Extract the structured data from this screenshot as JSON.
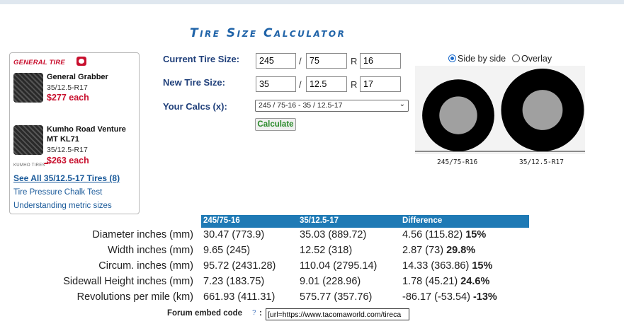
{
  "title": "Tire Size Calculator",
  "ad": {
    "brand1": "GENERAL TIRE",
    "product1": {
      "name": "General Grabber",
      "size": "35/12.5-R17",
      "price": "$277 each"
    },
    "brand2": "KUMHO TIRES",
    "product2": {
      "name_line1": "Kumho Road Venture",
      "name_line2": "MT KL71",
      "size": "35/12.5-R17",
      "price": "$263 each"
    },
    "see_all": "See All 35/12.5-17 Tires (8)",
    "link1": "Tire Pressure Chalk Test",
    "link2": "Understanding metric sizes"
  },
  "form": {
    "current_label": "Current Tire Size:",
    "current": {
      "width": "245",
      "ratio": "75",
      "rim": "16"
    },
    "new_label": "New Tire Size:",
    "new": {
      "width": "35",
      "ratio": "12.5",
      "rim": "17"
    },
    "sep_slash": "/",
    "sep_r": "R",
    "calcs_label": "Your Calcs (x):",
    "calcs_selected": "245 / 75-16 - 35 / 12.5-17",
    "calculate_label": "Calculate"
  },
  "view": {
    "side_by_side": "Side by side",
    "overlay": "Overlay",
    "selected": "side_by_side"
  },
  "diagram": {
    "tire1_label": "245/75-R16",
    "tire2_label": "35/12.5-R17",
    "tire1_diameter": 30.47,
    "tire1_rim": 16,
    "tire2_diameter": 35.03,
    "tire2_rim": 17,
    "tire_color": "#000000",
    "rim_color": "#a0a0a0"
  },
  "results": {
    "headers": [
      "245/75-16",
      "35/12.5-17",
      "Difference"
    ],
    "rows": [
      {
        "label": "Diameter inches (mm)",
        "a": "30.47 (773.9)",
        "b": "35.03 (889.72)",
        "diff": "4.56 (115.82)",
        "pct": "15%"
      },
      {
        "label": "Width inches (mm)",
        "a": "9.65 (245)",
        "b": "12.52 (318)",
        "diff": "2.87 (73)",
        "pct": "29.8%"
      },
      {
        "label": "Circum. inches (mm)",
        "a": "95.72 (2431.28)",
        "b": "110.04 (2795.14)",
        "diff": "14.33 (363.86)",
        "pct": "15%"
      },
      {
        "label": "Sidewall Height inches (mm)",
        "a": "7.23 (183.75)",
        "b": "9.01 (228.96)",
        "diff": "1.78 (45.21)",
        "pct": "24.6%"
      },
      {
        "label": "Revolutions per mile (km)",
        "a": "661.93 (411.31)",
        "b": "575.77 (357.76)",
        "diff": "-86.17 (-53.54)",
        "pct": "-13%"
      }
    ]
  },
  "embed": {
    "label": "Forum embed code",
    "help": "?",
    "colon": ":",
    "value": "[url=https://www.tacomaworld.com/tireca"
  },
  "colors": {
    "accent": "#1f7ab5",
    "title": "#1f63a8",
    "price": "#c8102e"
  }
}
